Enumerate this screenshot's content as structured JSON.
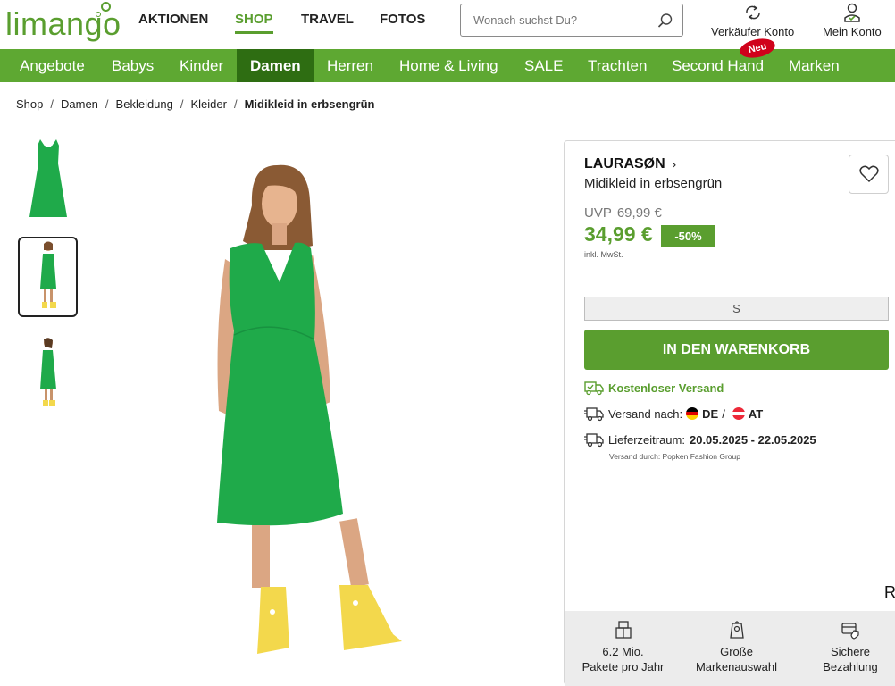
{
  "header": {
    "logo_text": "limango",
    "nav": [
      {
        "label": "AKTIONEN",
        "active": false
      },
      {
        "label": "SHOP",
        "active": true
      },
      {
        "label": "TRAVEL",
        "active": false
      },
      {
        "label": "FOTOS",
        "active": false
      }
    ],
    "search_placeholder": "Wonach suchst Du?",
    "seller_account": "Verkäufer Konto",
    "my_account": "Mein Konto"
  },
  "category_nav": {
    "items": [
      "Angebote",
      "Babys",
      "Kinder",
      "Damen",
      "Herren",
      "Home & Living",
      "SALE",
      "Trachten",
      "Second Hand",
      "Marken"
    ],
    "active": "Damen",
    "new_badge": "Neu"
  },
  "breadcrumb": {
    "items": [
      "Shop",
      "Damen",
      "Bekleidung",
      "Kleider"
    ],
    "current": "Midikleid in erbsengrün",
    "separator": "/"
  },
  "product": {
    "brand": "LAURASØN",
    "name": "Midikleid in erbsengrün",
    "uvp_label": "UVP",
    "uvp_price": "69,99 €",
    "price": "34,99 €",
    "discount": "-50%",
    "vat_note": "inkl. MwSt.",
    "selected_size": "S",
    "cart_button": "IN DEN WARENKORB",
    "free_shipping": "Kostenloser Versand",
    "shipping_to_label": "Versand nach:",
    "shipping_countries": [
      "DE",
      "AT"
    ],
    "delivery_label": "Lieferzeitraum:",
    "delivery_range": "20.05.2025 - 22.05.2025",
    "shipped_by": "Versand durch: Popken Fashion Group",
    "cutoff_glyph": "R"
  },
  "usp": [
    {
      "line1": "6.2 Mio.",
      "line2": "Pakete pro Jahr",
      "icon": "parcel-icon"
    },
    {
      "line1": "Große",
      "line2": "Markenauswahl",
      "icon": "tag-icon"
    },
    {
      "line1": "Sichere",
      "line2": "Bezahlung",
      "icon": "secure-payment-icon"
    }
  ],
  "colors": {
    "brand_green": "#5a9e2f",
    "nav_green": "#5ea832",
    "nav_active": "#2e6d12",
    "dress_green": "#1faa4a",
    "boot_yellow": "#f3d84c",
    "badge_red": "#d0021b"
  }
}
